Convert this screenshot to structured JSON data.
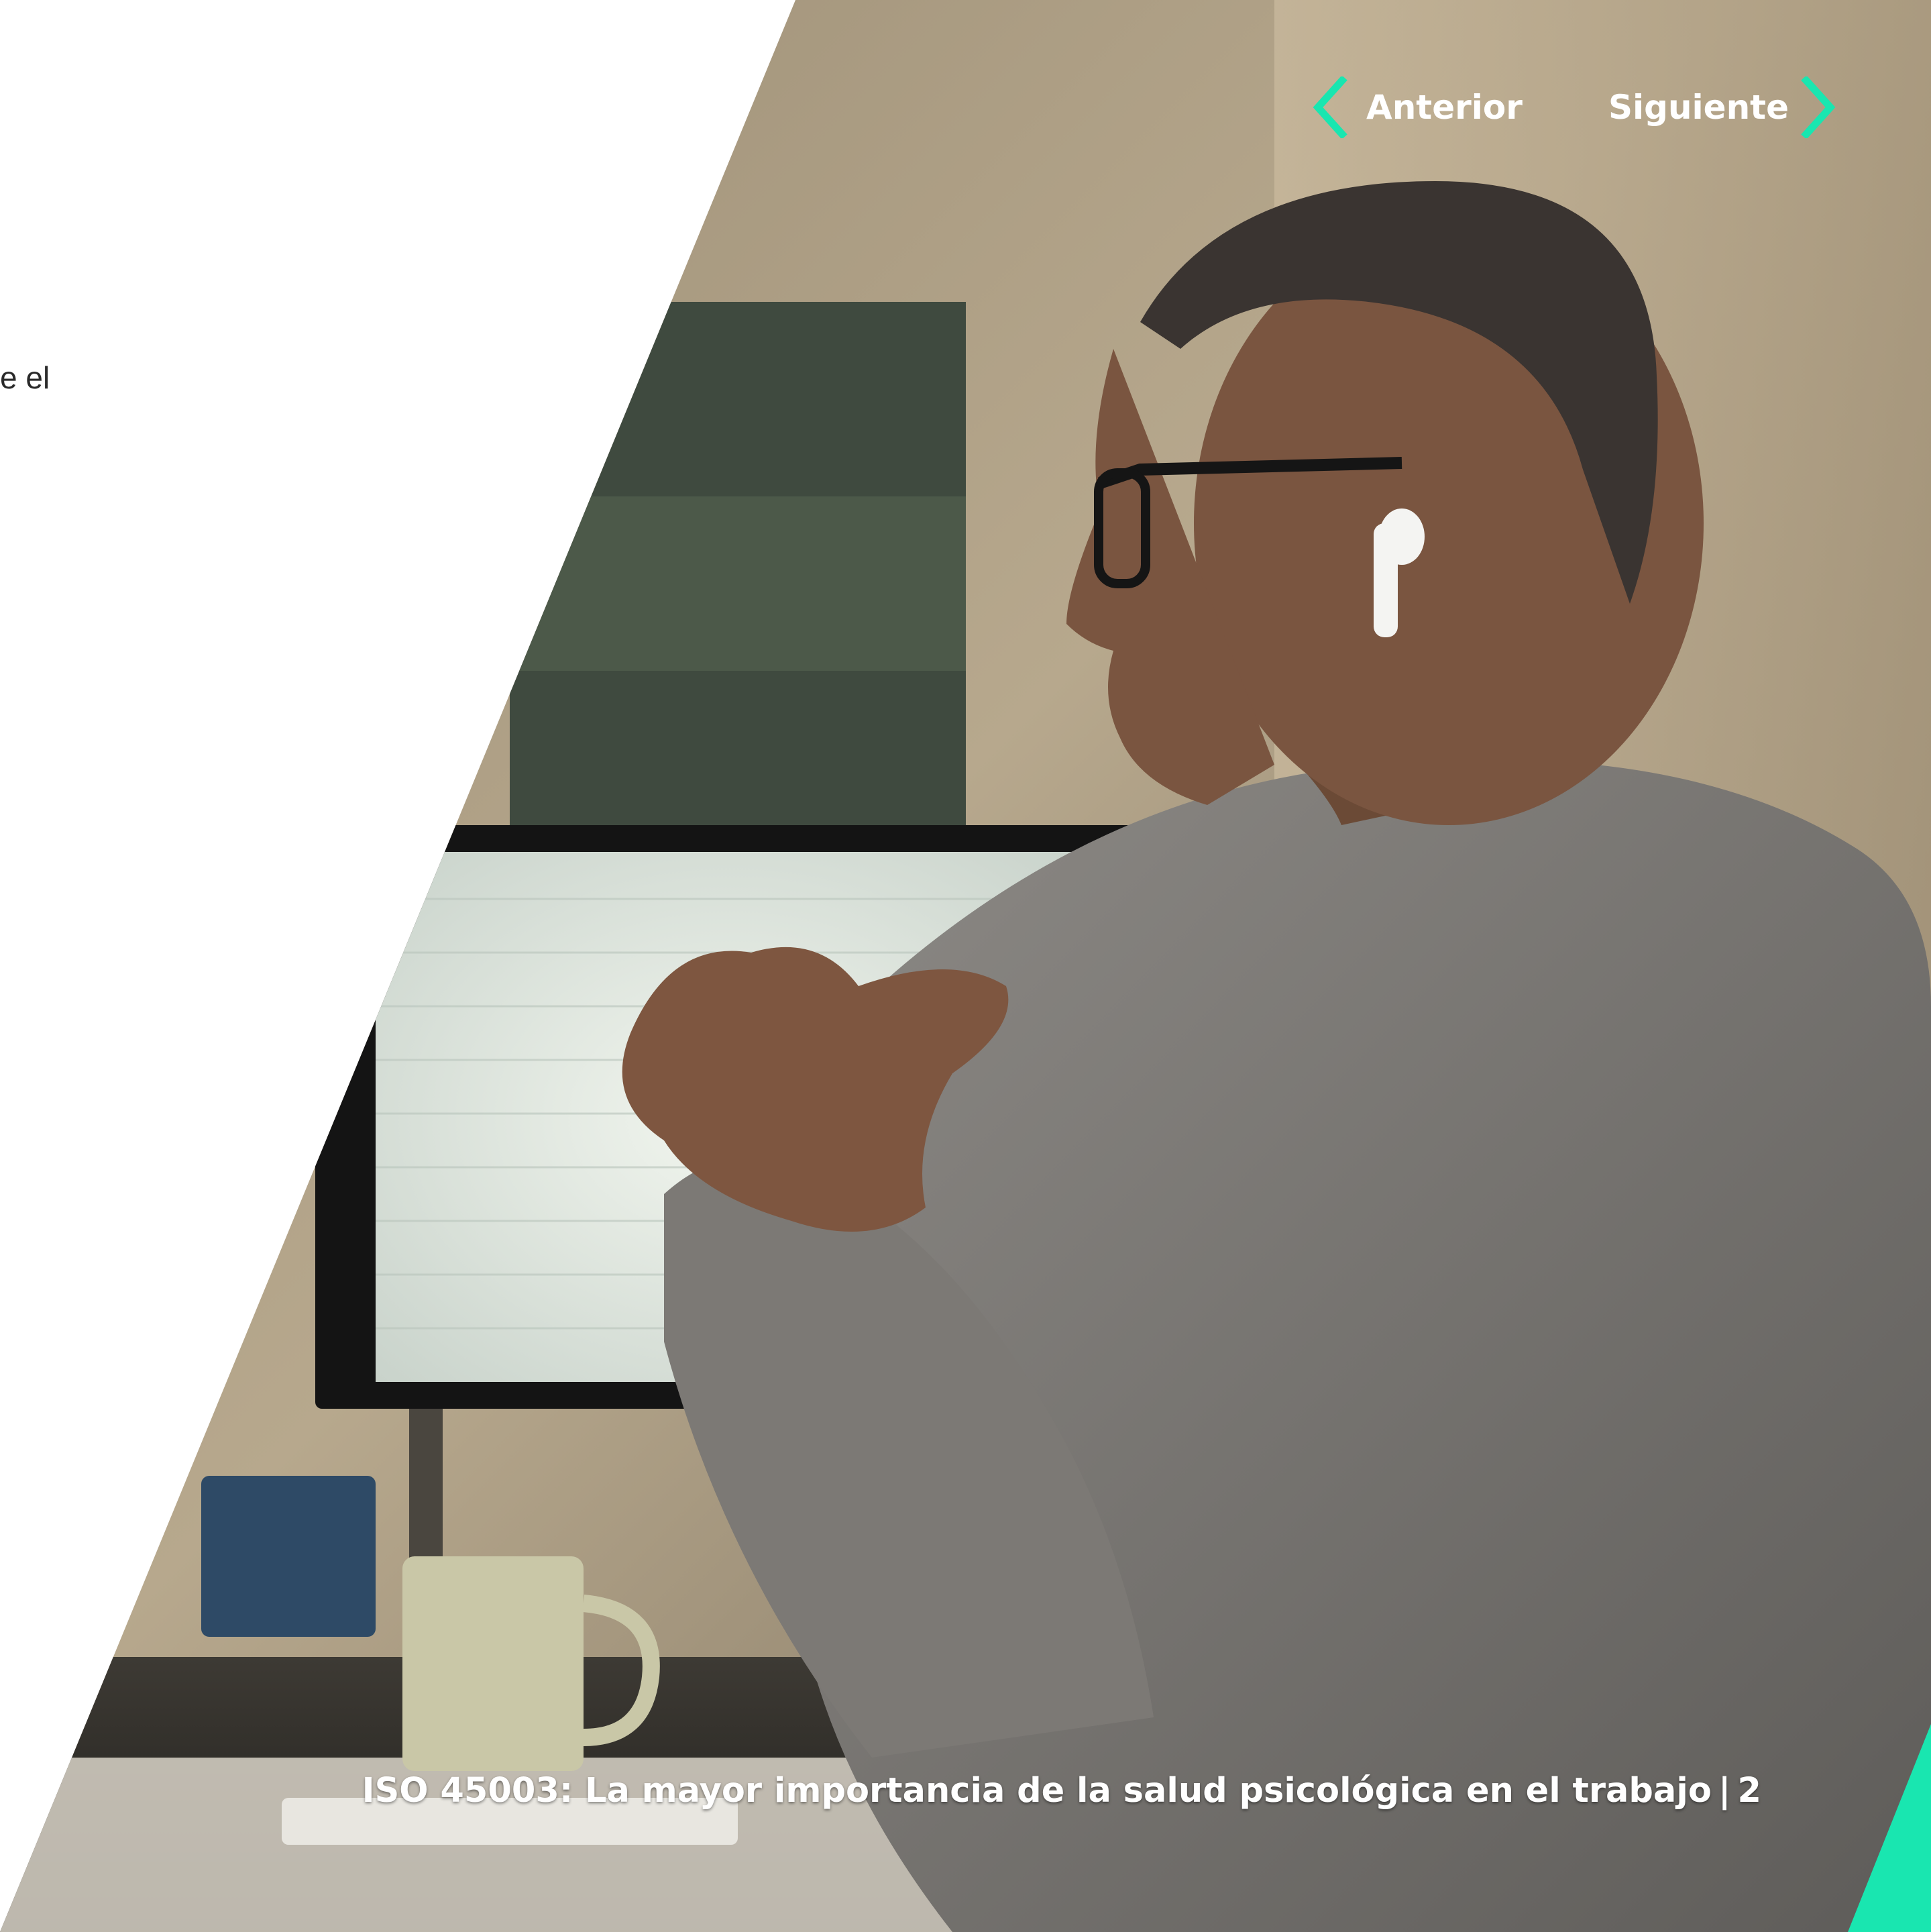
{
  "nav": {
    "prev_label": "Anterior",
    "next_label": "Siguiente"
  },
  "body_fragment": "e el",
  "footer": {
    "title": "ISO 45003: La mayor importancia de la salud psicológica en el trabajo",
    "separator": "|",
    "page_number": "2"
  },
  "photo": {
    "subject": "man with glasses and earbud, hands clasped, in front of computer monitor"
  },
  "colors": {
    "accent": "#19e6b0",
    "background": "#ffffff",
    "text_dark": "#2a2a2a",
    "text_light": "#ffffff"
  },
  "icons": [
    "chevron-left-icon",
    "chevron-right-icon"
  ]
}
